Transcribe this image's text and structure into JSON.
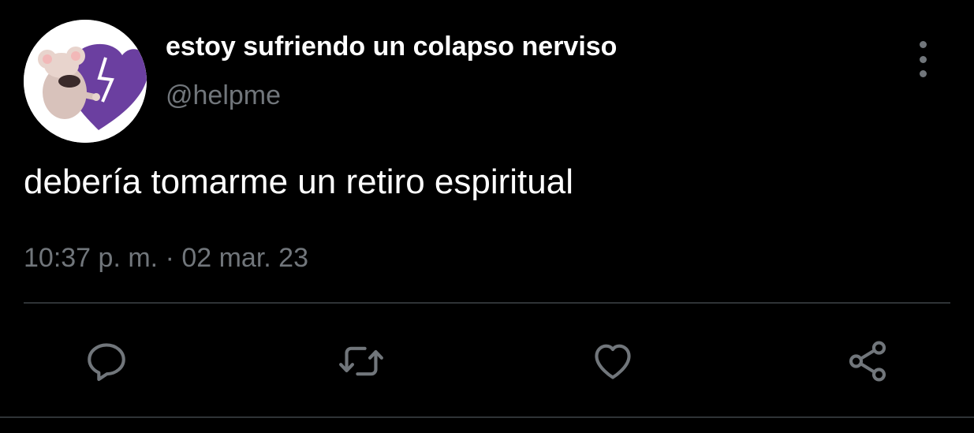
{
  "user": {
    "display_name": "estoy sufriendo un colapso nerviso",
    "handle": "@helpme",
    "avatar_icon": "broken-heart-mouse-avatar"
  },
  "tweet": {
    "text": "debería tomarme un retiro espiritual",
    "time": "10:37 p. m.",
    "separator": "·",
    "date": "02 mar. 23"
  },
  "actions": [
    {
      "name": "reply",
      "icon": "reply-icon"
    },
    {
      "name": "retweet",
      "icon": "retweet-icon"
    },
    {
      "name": "like",
      "icon": "heart-icon"
    },
    {
      "name": "share",
      "icon": "share-icon"
    }
  ],
  "colors": {
    "background": "#000000",
    "primary_text": "#ffffff",
    "secondary_text": "#71767b",
    "divider": "#2f3336",
    "avatar_heart": "#6b3fa0"
  }
}
